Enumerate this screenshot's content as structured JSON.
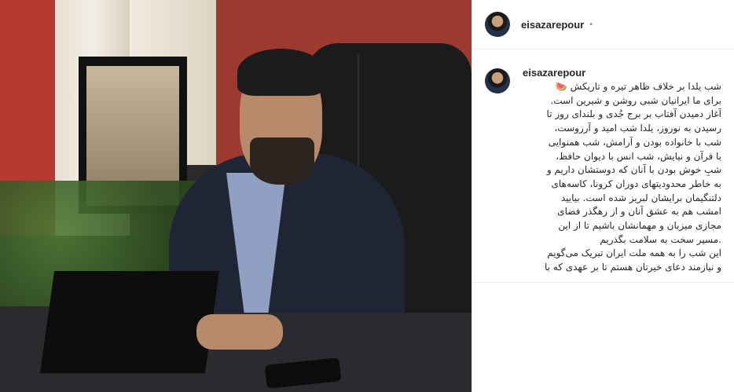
{
  "post": {
    "username": "eisazarepour",
    "header_separator": "•",
    "caption_username": "eisazarepour",
    "caption_lines": [
      "شب یلدا بر خلاف ظاهر تیره و تاریکش 🍉",
      "برای ما ایرانیان شبی روشن و شیرین است.",
      "آغاز دمیدن آفتاب بر برج جُدی و بلندای روز تا",
      "رسیدن به نوروز، یلدا شب امید و آرزوست،",
      "شب با خانواده بودن و آرامش، شب همنوایی",
      "با قرآن و نیایش، شب انس با دیوان حافظ،",
      "شبِ خوش بودن با آنان که دوستشان داریم و",
      "به خاطر محدودیتهای دوران کرونا، کاسه‌های",
      "دلتنگیمان برایشان لبریز شده است. بیایید",
      "امشب هم به عشق آنان و از رهگذر فضای",
      "مجازی میزبان و مهمانشان باشیم تا از این",
      ".مسیر سخت به سلامت بگذریم",
      "این شب را به همه ملت ایران تبریک می‌گویم",
      "و نیازمند دعای خیرتان هستم تا بر عهدی که با"
    ]
  }
}
